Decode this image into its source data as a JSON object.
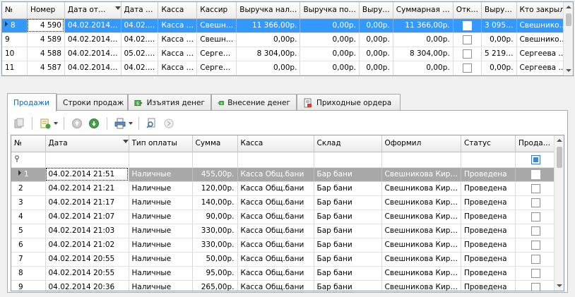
{
  "top_grid": {
    "columns": [
      "№",
      "Номер",
      "Дата от…",
      "Дата …",
      "Касса",
      "Кассир",
      "Выручка нал…",
      "Выручка по…",
      "Выру…",
      "Суммарная …",
      "Отк…",
      "Выру…",
      "Кто закрыл"
    ],
    "rows": [
      {
        "n": "8",
        "num": "4 590",
        "d1": "04.02.2014…",
        "d2": "04.02.…",
        "kassa": "Касса …",
        "kassir": "Свешн…",
        "v_nal": "11 366,00р.",
        "v_po": "0,00р.",
        "v3": "0,00р.",
        "sum": "11 366,00р.",
        "v5": "3 095…",
        "closed": "Свешнико…"
      },
      {
        "n": "9",
        "num": "4 589",
        "d1": "04.02.2014…",
        "d2": "04.02.…",
        "kassa": "Касса …",
        "kassir": "Свешн…",
        "v_nal": "0,00р.",
        "v_po": "0,00р.",
        "v3": "0,00р.",
        "sum": "0,00р.",
        "v5": "0,00р.",
        "closed": "Свешнико…"
      },
      {
        "n": "10",
        "num": "4 588",
        "d1": "04.02.2014…",
        "d2": "05.02.…",
        "kassa": "Касса …",
        "kassir": "Серге…",
        "v_nal": "8 304,00р.",
        "v_po": "0,00р.",
        "v3": "0,00р.",
        "sum": "8 304,00р.",
        "v5": "5 219…",
        "closed": "Сергеева …"
      },
      {
        "n": "11",
        "num": "4 587",
        "d1": "04.02.2014…",
        "d2": "04.02.…",
        "kassa": "Касса …",
        "kassir": "Серге…",
        "v_nal": "0,00р.",
        "v_po": "0,00р.",
        "v3": "0,00р.",
        "sum": "0,00р.",
        "v5": "0,00р.",
        "closed": "Сергеева …"
      }
    ]
  },
  "tabs": [
    {
      "label": "Продажи",
      "icon": "none"
    },
    {
      "label": "Строки продаж",
      "icon": "none"
    },
    {
      "label": "Изъятия денег",
      "icon": "money-out-icon"
    },
    {
      "label": "Внесение денег",
      "icon": "money-in-icon"
    },
    {
      "label": "Приходные ордера",
      "icon": "document-icon"
    }
  ],
  "bottom_grid": {
    "columns": [
      "№",
      "Дата",
      "Тип оплаты",
      "Сумма",
      "Касса",
      "Склад",
      "Оформил",
      "Статус",
      "Прода…"
    ],
    "rows": [
      {
        "n": "1",
        "date": "04.02.2014 21:51",
        "type": "Наличные",
        "sum": "455,00р.",
        "kassa": "Касса Общ.бани",
        "sklad": "Бар бани",
        "by": "Свешникова  Кир…",
        "status": "Проведена"
      },
      {
        "n": "2",
        "date": "04.02.2014 21:21",
        "type": "Наличные",
        "sum": "120,00р.",
        "kassa": "Касса Общ.бани",
        "sklad": "Бар бани",
        "by": "Свешникова  Кир…",
        "status": "Проведена"
      },
      {
        "n": "3",
        "date": "04.02.2014 21:17",
        "type": "Наличные",
        "sum": "140,00р.",
        "kassa": "Касса Общ.бани",
        "sklad": "Бар бани",
        "by": "Свешникова  Кир…",
        "status": "Проведена"
      },
      {
        "n": "4",
        "date": "04.02.2014 21:07",
        "type": "Наличные",
        "sum": "90,00р.",
        "kassa": "Касса Общ.бани",
        "sklad": "Бар бани",
        "by": "Свешникова  Кир…",
        "status": "Проведена"
      },
      {
        "n": "5",
        "date": "04.02.2014 21:03",
        "type": "Наличные",
        "sum": "330,00р.",
        "kassa": "Касса Общ.бани",
        "sklad": "Бар бани",
        "by": "Свешникова  Кир…",
        "status": "Проведена"
      },
      {
        "n": "6",
        "date": "04.02.2014 21:02",
        "type": "Наличные",
        "sum": "330,00р.",
        "kassa": "Касса Общ.бани",
        "sklad": "Бар бани",
        "by": "Свешникова  Кир…",
        "status": "Проведена"
      },
      {
        "n": "7",
        "date": "04.02.2014 20:55",
        "type": "Наличные",
        "sum": "50,00р.",
        "kassa": "Касса Общ.бани",
        "sklad": "Бар бани",
        "by": "Свешникова  Кир…",
        "status": "Проведена"
      },
      {
        "n": "8",
        "date": "04.02.2014 20:55",
        "type": "Наличные",
        "sum": "95,00р.",
        "kassa": "Касса Общ.бани",
        "sklad": "Бар бани",
        "by": "Свешникова  Кир…",
        "status": "Проведена"
      },
      {
        "n": "9",
        "date": "04.02.2014 20:36",
        "type": "Наличные",
        "sum": "265,00р.",
        "kassa": "Касса Общ.бани",
        "sklad": "Бар бани",
        "by": "Свешникова  Кир…",
        "status": "Проведена"
      }
    ]
  },
  "colors": {
    "selection": "#3399ff",
    "selection_gray": "#a8a8a8",
    "active_tab_text": "#1565c0"
  }
}
